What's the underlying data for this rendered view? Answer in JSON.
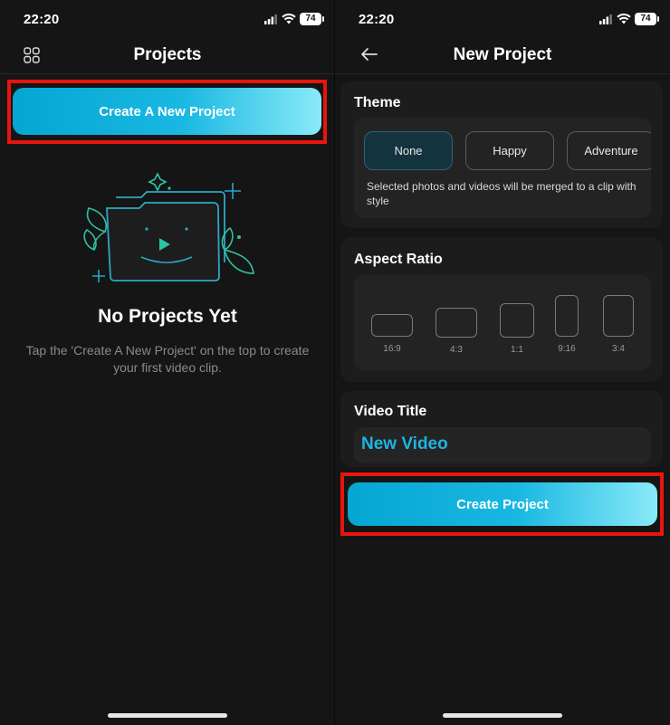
{
  "left": {
    "status": {
      "time": "22:20",
      "battery": "74"
    },
    "header": {
      "title": "Projects",
      "menu_icon": "grid-icon"
    },
    "create_button_label": "Create A New Project",
    "empty": {
      "title": "No Projects Yet",
      "description": "Tap the 'Create A New Project' on the top to create your first video clip."
    }
  },
  "right": {
    "status": {
      "time": "22:20",
      "battery": "74"
    },
    "header": {
      "title": "New Project",
      "back_icon": "arrow-left-icon"
    },
    "theme": {
      "title": "Theme",
      "options": [
        {
          "label": "None",
          "selected": true
        },
        {
          "label": "Happy",
          "selected": false
        },
        {
          "label": "Adventure",
          "selected": false
        }
      ],
      "note": "Selected photos and videos will be merged to a clip with style"
    },
    "aspect_ratio": {
      "title": "Aspect Ratio",
      "options": [
        "16:9",
        "4:3",
        "1:1",
        "9:16",
        "3:4"
      ]
    },
    "video_title": {
      "title": "Video Title",
      "value": "New Video"
    },
    "create_button_label": "Create Project"
  },
  "colors": {
    "accent": "#1fb4e0",
    "highlight": "#e8150c",
    "background": "#151515"
  }
}
